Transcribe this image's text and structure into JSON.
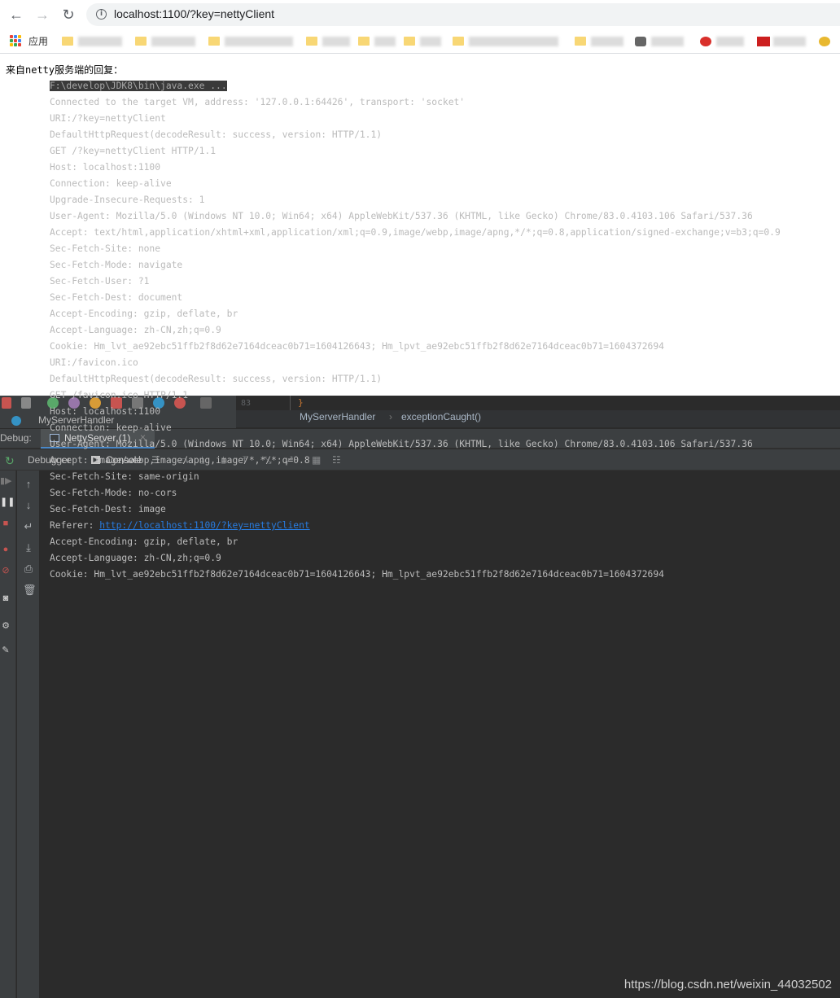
{
  "browser": {
    "url": "localhost:1100/?key=nettyClient",
    "bookmarks_apps_label": "应用",
    "page_text": "来自netty服务端的回复："
  },
  "ide": {
    "line_number": "83",
    "editor_brace": "}",
    "structure_label": "MyServerHandler",
    "breadcrumb": [
      "MyServerHandler",
      "exceptionCaught()"
    ],
    "breadcrumb_sep": "›",
    "debug_label": "Debug:",
    "session_tab": "NettyServer (1)",
    "session_close": "×",
    "subtabs": {
      "debugger": "Debugger",
      "console": "Console"
    },
    "console": {
      "command": "F:\\develop\\JDK8\\bin\\java.exe ...",
      "lines": [
        "Connected to the target VM, address: '127.0.0.1:64426', transport: 'socket'",
        "URI:/?key=nettyClient",
        "DefaultHttpRequest(decodeResult: success, version: HTTP/1.1)",
        "GET /?key=nettyClient HTTP/1.1",
        "Host: localhost:1100",
        "Connection: keep-alive",
        "Upgrade-Insecure-Requests: 1",
        "User-Agent: Mozilla/5.0 (Windows NT 10.0; Win64; x64) AppleWebKit/537.36 (KHTML, like Gecko) Chrome/83.0.4103.106 Safari/537.36",
        "Accept: text/html,application/xhtml+xml,application/xml;q=0.9,image/webp,image/apng,*/*;q=0.8,application/signed-exchange;v=b3;q=0.9",
        "Sec-Fetch-Site: none",
        "Sec-Fetch-Mode: navigate",
        "Sec-Fetch-User: ?1",
        "Sec-Fetch-Dest: document",
        "Accept-Encoding: gzip, deflate, br",
        "Accept-Language: zh-CN,zh;q=0.9",
        "Cookie: Hm_lvt_ae92ebc51ffb2f8d62e7164dceac0b71=1604126643; Hm_lpvt_ae92ebc51ffb2f8d62e7164dceac0b71=1604372694",
        "URI:/favicon.ico",
        "DefaultHttpRequest(decodeResult: success, version: HTTP/1.1)",
        "GET /favicon.ico HTTP/1.1",
        "Host: localhost:1100",
        "Connection: keep-alive",
        "User-Agent: Mozilla/5.0 (Windows NT 10.0; Win64; x64) AppleWebKit/537.36 (KHTML, like Gecko) Chrome/83.0.4103.106 Safari/537.36",
        "Accept: image/webp,image/apng,image/*,*/*;q=0.8",
        "Sec-Fetch-Site: same-origin",
        "Sec-Fetch-Mode: no-cors",
        "Sec-Fetch-Dest: image"
      ],
      "referer_prefix": "Referer: ",
      "referer_link": "http://localhost:1100/?key=nettyClient",
      "lines_after": [
        "Accept-Encoding: gzip, deflate, br",
        "Accept-Language: zh-CN,zh;q=0.9",
        "Cookie: Hm_lvt_ae92ebc51ffb2f8d62e7164dceac0b71=1604126643; Hm_lpvt_ae92ebc51ffb2f8d62e7164dceac0b71=1604372694"
      ]
    }
  },
  "watermark": "https://blog.csdn.net/weixin_44032502",
  "colors": {
    "ide_bg": "#2b2b2b",
    "panel_bg": "#3c3f41",
    "console_text": "#bbbbbb",
    "link": "#287bde"
  }
}
